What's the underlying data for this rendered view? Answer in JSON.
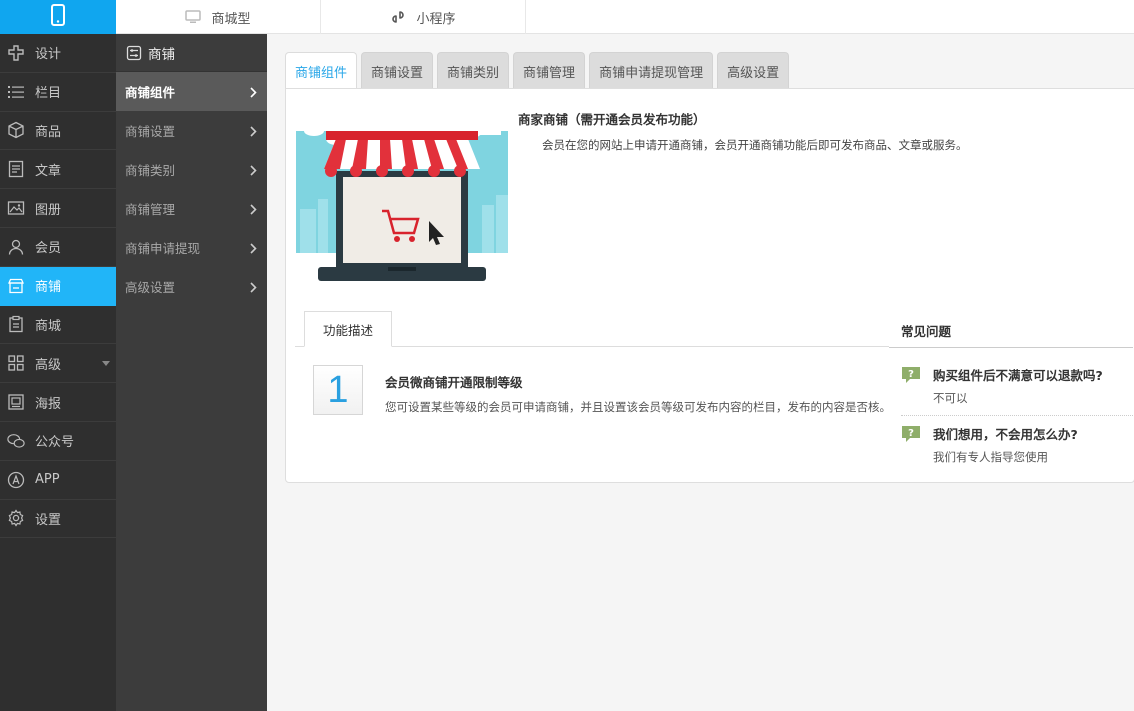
{
  "topbar": {
    "tabs": [
      {
        "label": "商城型",
        "icon": "monitor-icon"
      },
      {
        "label": "小程序",
        "icon": "link-icon"
      }
    ]
  },
  "sidebar": {
    "items": [
      {
        "label": "设计",
        "icon": "design-icon"
      },
      {
        "label": "栏目",
        "icon": "list-icon"
      },
      {
        "label": "商品",
        "icon": "box-icon"
      },
      {
        "label": "文章",
        "icon": "article-icon"
      },
      {
        "label": "图册",
        "icon": "image-icon"
      },
      {
        "label": "会员",
        "icon": "user-icon"
      },
      {
        "label": "商铺",
        "icon": "store-icon",
        "active": true
      },
      {
        "label": "商城",
        "icon": "clipboard-icon"
      },
      {
        "label": "高级",
        "icon": "grid-icon"
      },
      {
        "label": "海报",
        "icon": "poster-icon"
      },
      {
        "label": "公众号",
        "icon": "wechat-icon"
      },
      {
        "label": "APP",
        "icon": "app-icon"
      },
      {
        "label": "设置",
        "icon": "gear-icon"
      }
    ]
  },
  "subbar": {
    "title": "商铺",
    "items": [
      {
        "label": "商铺组件",
        "active": true
      },
      {
        "label": "商铺设置"
      },
      {
        "label": "商铺类别"
      },
      {
        "label": "商铺管理"
      },
      {
        "label": "商铺申请提现"
      },
      {
        "label": "高级设置"
      }
    ]
  },
  "tabs": [
    {
      "label": "商铺组件",
      "active": true
    },
    {
      "label": "商铺设置"
    },
    {
      "label": "商铺类别"
    },
    {
      "label": "商铺管理"
    },
    {
      "label": "商铺申请提现管理"
    },
    {
      "label": "高级设置"
    }
  ],
  "intro": {
    "title": "商家商铺（需开通会员发布功能）",
    "text": "会员在您的网站上申请开通商铺，会员开通商铺功能后即可发布商品、文章或服务。"
  },
  "features": {
    "tab_label": "功能描述",
    "step_number": "1",
    "step_title": "会员微商铺开通限制等级",
    "step_desc": "您可设置某些等级的会员可申请商铺，并且设置该会员等级可发布内容的栏目，发布的内容是否核。"
  },
  "faq": {
    "title": "常见问题",
    "items": [
      {
        "q": "购买组件后不满意可以退款吗?",
        "a": "不可以"
      },
      {
        "q": "我们想用，不会用怎么办?",
        "a": "我们有专人指导您使用"
      }
    ]
  },
  "colors": {
    "accent": "#21b5f8",
    "sidebar_bg": "#2f2f2f",
    "subbar_bg": "#3c3c3c"
  }
}
